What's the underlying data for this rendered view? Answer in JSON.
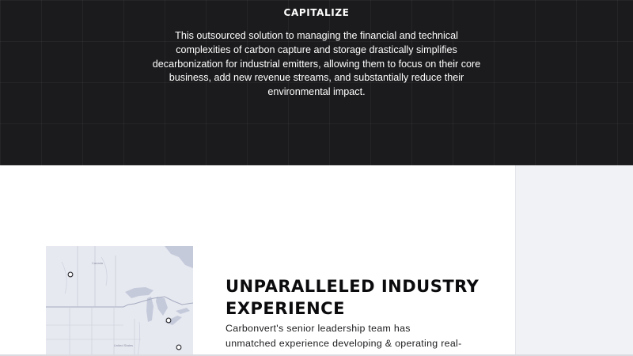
{
  "capitalize": {
    "heading": "CAPITALIZE",
    "body": "This outsourced solution to managing the financial and technical complexities of carbon capture and storage drastically simplifies decarbonization for industrial emitters, allowing them to focus on their core business, add new revenue streams, and substantially reduce their environmental impact."
  },
  "experience": {
    "title": "UNPARALLELED INDUSTRY EXPERIENCE",
    "body": "Carbonvert's senior leadership team has unmatched experience developing & operating real-world, large-scale CCS projects across North America."
  },
  "map": {
    "region_labels": [
      "Canada",
      "United States"
    ]
  },
  "colors": {
    "dark_background": "#1b1a1c",
    "panel_background": "#f1f2f6",
    "map_background": "#e6e8ef",
    "water": "#c5cadb"
  }
}
